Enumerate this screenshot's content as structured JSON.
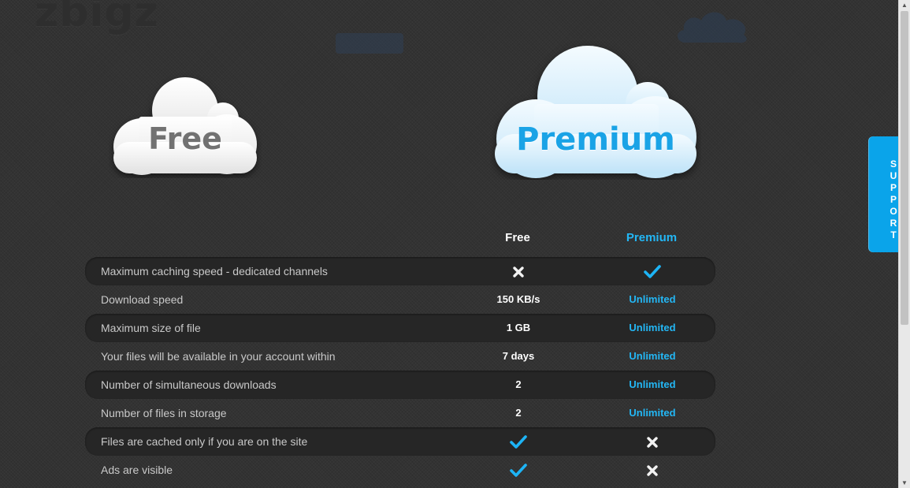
{
  "logo": "zbigz",
  "clouds": {
    "free_label": "Free",
    "premium_label": "Premium"
  },
  "columns": {
    "free": "Free",
    "premium": "Premium"
  },
  "rows": [
    {
      "label": "Maximum caching speed - dedicated channels",
      "free": "cross-icon",
      "premium": "check-icon"
    },
    {
      "label": "Download speed",
      "free": "150 KB/s",
      "premium": "Unlimited"
    },
    {
      "label": "Maximum size of file",
      "free": "1 GB",
      "premium": "Unlimited"
    },
    {
      "label": "Your files will be available in your account within",
      "free": "7 days",
      "premium": "Unlimited"
    },
    {
      "label": "Number of simultaneous downloads",
      "free": "2",
      "premium": "Unlimited"
    },
    {
      "label": "Number of files in storage",
      "free": "2",
      "premium": "Unlimited"
    },
    {
      "label": "Files are cached only if you are on the site",
      "free": "check-icon",
      "premium": "cross-icon"
    },
    {
      "label": "Ads are visible",
      "free": "check-icon",
      "premium": "cross-icon"
    }
  ],
  "support_tab": "SUPPORT",
  "colors": {
    "accent": "#23b7f5",
    "support": "#0aa4ea",
    "background": "#333333"
  }
}
